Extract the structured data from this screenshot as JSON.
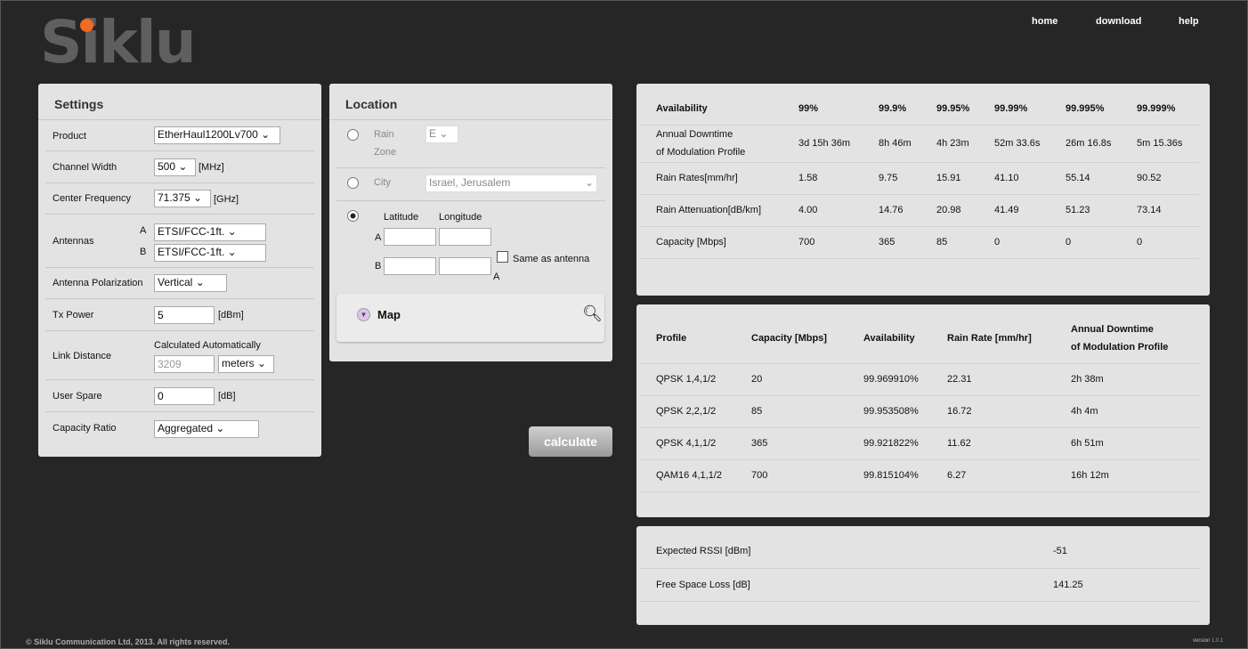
{
  "brand": "Siklu",
  "nav": {
    "home": "home",
    "download": "download",
    "help": "help"
  },
  "settings": {
    "title": "Settings",
    "product_label": "Product",
    "product": "EtherHaul1200Lv700",
    "channel_width_label": "Channel Width",
    "channel_width": "500",
    "channel_width_unit": "[MHz]",
    "center_freq_label": "Center Frequency",
    "center_freq": "71.375",
    "center_freq_unit": "[GHz]",
    "antennas_label": "Antennas",
    "antenna_a_label": "A",
    "antenna_a": "ETSI/FCC-1ft.",
    "antenna_b_label": "B",
    "antenna_b": "ETSI/FCC-1ft.",
    "polarization_label": "Antenna Polarization",
    "polarization": "Vertical",
    "tx_power_label": "Tx Power",
    "tx_power": "5",
    "tx_power_unit": "[dBm]",
    "link_distance_label": "Link Distance",
    "link_distance_note": "Calculated Automatically",
    "link_distance": "3209",
    "link_distance_unit": "meters",
    "user_spare_label": "User Spare",
    "user_spare": "0",
    "user_spare_unit": "[dB]",
    "capacity_ratio_label": "Capacity Ratio",
    "capacity_ratio": "Aggregated"
  },
  "location": {
    "title": "Location",
    "rain_label": "Rain",
    "zone_label": "Zone",
    "rain_zone": "E",
    "city_label": "City",
    "city": "Israel, Jerusalem",
    "latitude_label": "Latitude",
    "longitude_label": "Longitude",
    "a_label": "A",
    "b_label": "B",
    "same_as_antenna": "Same as antenna",
    "same_a": "A",
    "map_label": "Map"
  },
  "calculate": "calculate",
  "availability": {
    "header": [
      "Availability",
      "99%",
      "99.9%",
      "99.95%",
      "99.99%",
      "99.995%",
      "99.999%"
    ],
    "rows": [
      [
        "Annual Downtime|of Modulation Profile",
        "3d 15h 36m",
        "8h 46m",
        "4h 23m",
        "52m 33.6s",
        "26m 16.8s",
        "5m 15.36s"
      ],
      [
        "Rain Rates[mm/hr]",
        "1.58",
        "9.75",
        "15.91",
        "41.10",
        "55.14",
        "90.52"
      ],
      [
        "Rain Attenuation[dB/km]",
        "4.00",
        "14.76",
        "20.98",
        "41.49",
        "51.23",
        "73.14"
      ],
      [
        "Capacity [Mbps]",
        "700",
        "365",
        "85",
        "0",
        "0",
        "0"
      ]
    ]
  },
  "profiles": {
    "header": [
      "Profile",
      "Capacity [Mbps]",
      "Availability",
      "Rain Rate [mm/hr]",
      "Annual Downtime|of Modulation Profile"
    ],
    "rows": [
      [
        "QPSK 1,4,1/2",
        "20",
        "99.969910%",
        "22.31",
        "2h 38m"
      ],
      [
        "QPSK 2,2,1/2",
        "85",
        "99.953508%",
        "16.72",
        "4h 4m"
      ],
      [
        "QPSK 4,1,1/2",
        "365",
        "99.921822%",
        "11.62",
        "6h 51m"
      ],
      [
        "QAM16 4,1,1/2",
        "700",
        "99.815104%",
        "6.27",
        "16h 12m"
      ]
    ]
  },
  "link": {
    "rows": [
      [
        "Expected RSSI [dBm]",
        "-51"
      ],
      [
        "Free Space Loss [dB]",
        "141.25"
      ]
    ]
  },
  "footer": {
    "copyright": "© Siklu Communication Ltd, 2013. All rights reserved.",
    "version_label": "version",
    "version": "1.0.1"
  }
}
